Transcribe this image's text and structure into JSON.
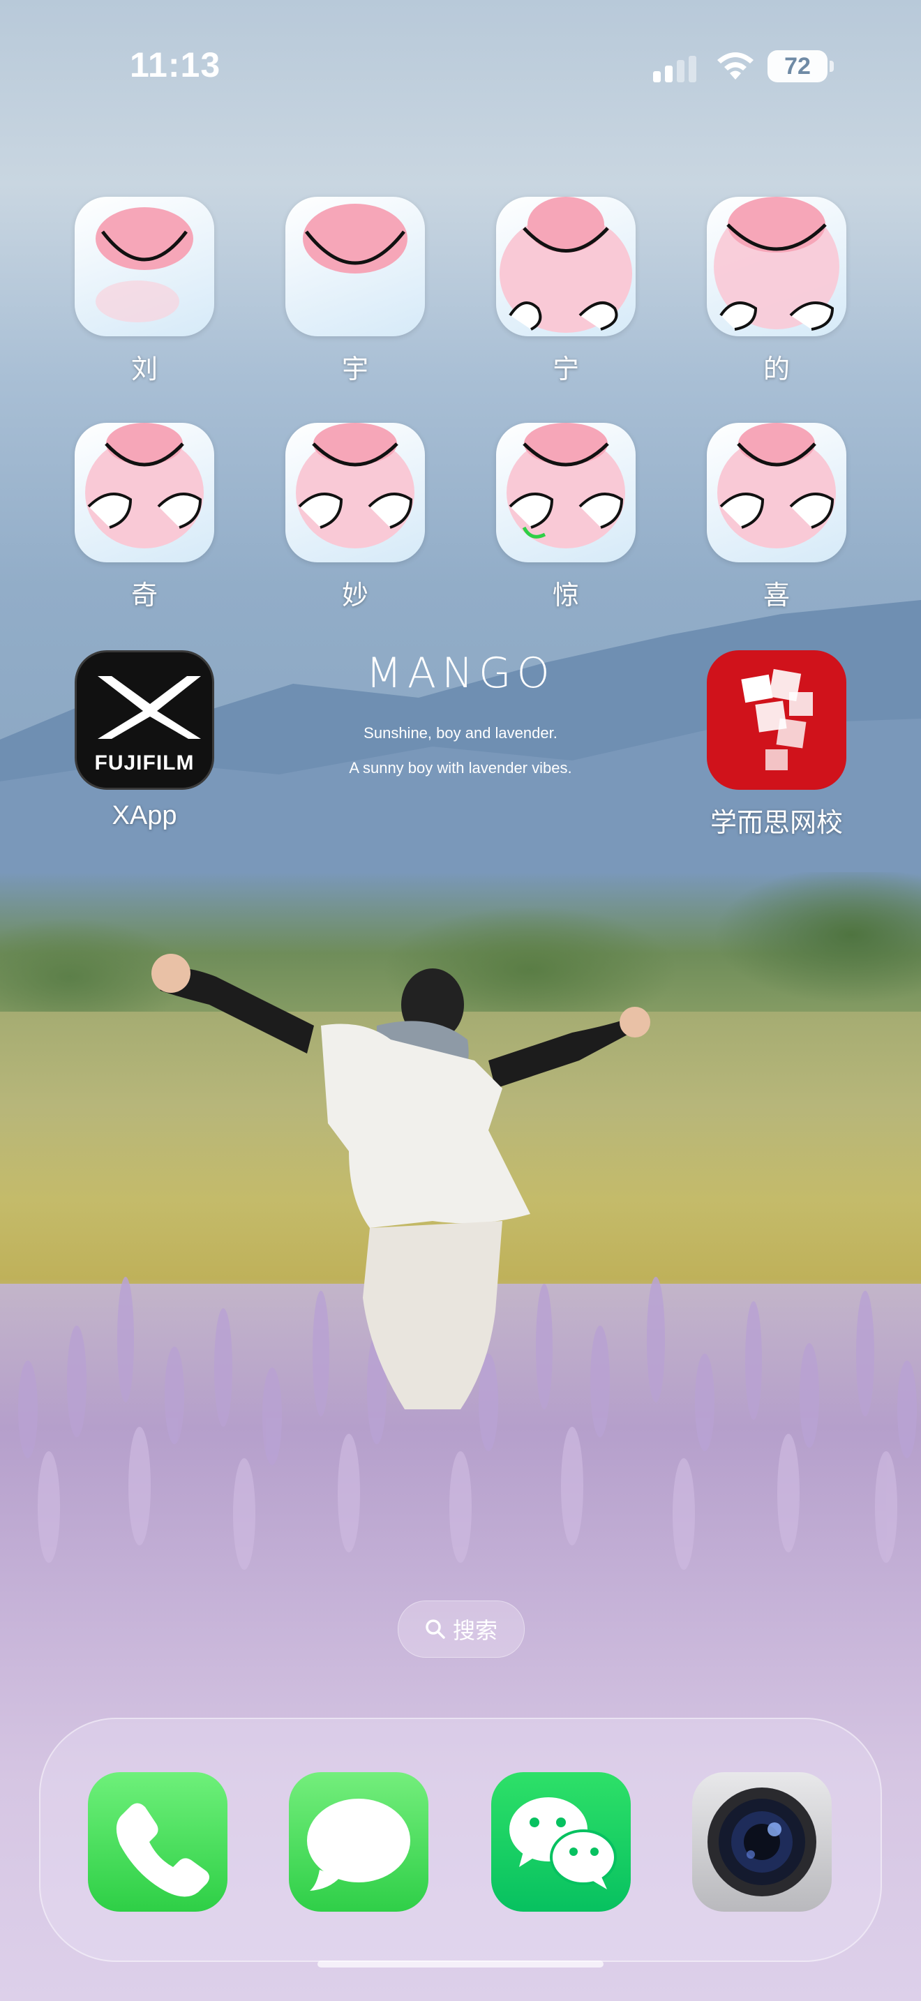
{
  "status_bar": {
    "time": "11:13",
    "battery": "72",
    "icons": [
      "cellular-signal-icon",
      "wifi-icon",
      "battery-icon"
    ]
  },
  "home": {
    "row1": [
      {
        "label": "刘",
        "icon": "cute-character-icon"
      },
      {
        "label": "宇",
        "icon": "cute-character-icon"
      },
      {
        "label": "宁",
        "icon": "cute-character-icon"
      },
      {
        "label": "的",
        "icon": "cute-character-icon"
      }
    ],
    "row2": [
      {
        "label": "奇",
        "icon": "cute-character-icon"
      },
      {
        "label": "妙",
        "icon": "cute-character-icon"
      },
      {
        "label": "惊",
        "icon": "cute-character-icon"
      },
      {
        "label": "喜",
        "icon": "cute-character-icon"
      }
    ],
    "xapp": {
      "label": "XApp",
      "brand": "FUJIFILM"
    },
    "xueersi": {
      "label": "学而思网校"
    }
  },
  "widget": {
    "title": "MANGO",
    "line1": "Sunshine, boy and lavender.",
    "line2": "A sunny boy with lavender vibes."
  },
  "search": {
    "label": "搜索"
  },
  "dock": {
    "apps": [
      "phone-icon",
      "messages-icon",
      "wechat-icon",
      "camera-icon"
    ]
  },
  "colors": {
    "fujifilm_bg": "#111111",
    "xueersi_red": "#d0121b",
    "ios_green": "#2ecf46",
    "wechat_green": "#07c160"
  }
}
